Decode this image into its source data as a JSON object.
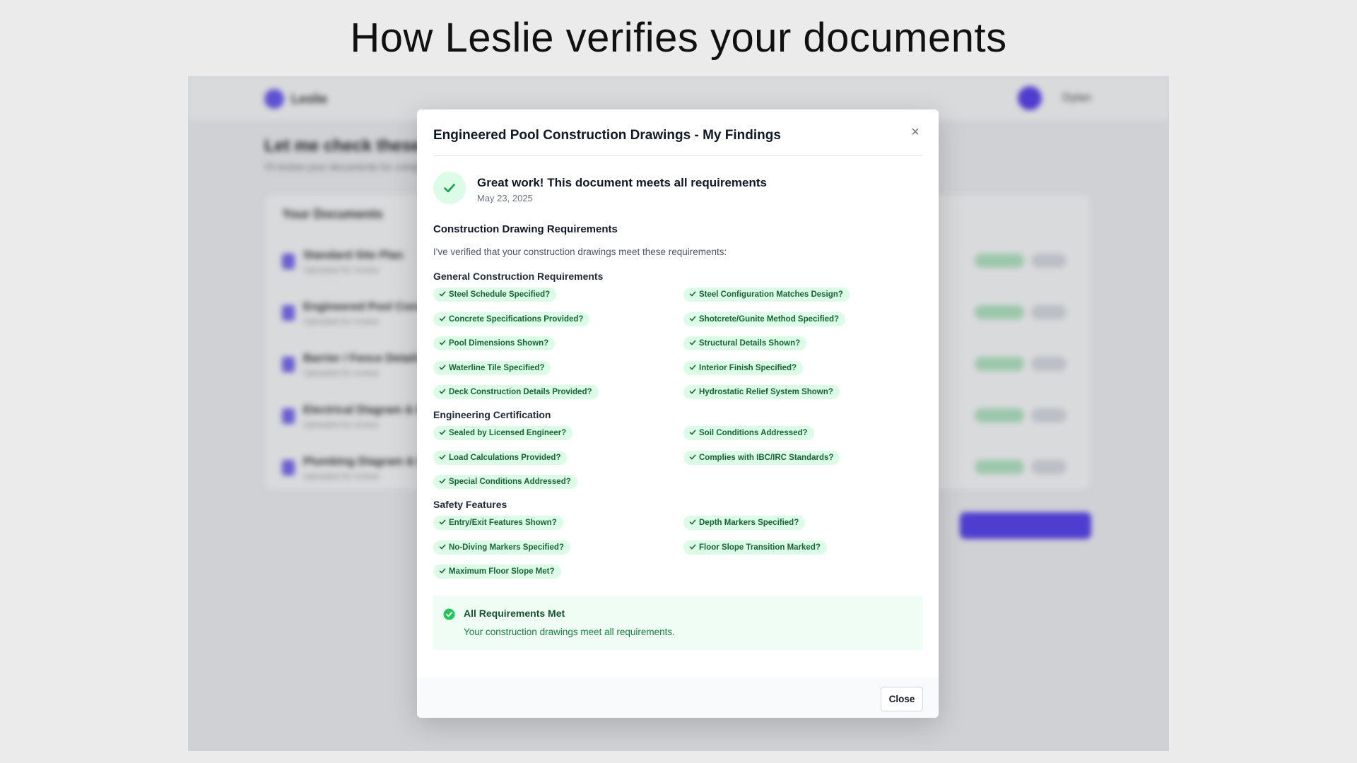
{
  "headline": "How Leslie verifies your documents",
  "app": {
    "logo_text": "Leslie",
    "user_name": "Dylan",
    "page_title": "Let me check these documents",
    "page_subtitle": "I'll review your documents for completeness",
    "docs_card_title": "Your Documents",
    "documents": [
      {
        "name": "Standard Site Plan",
        "meta": "Uploaded for review"
      },
      {
        "name": "Engineered Pool Construction Drawings",
        "meta": "Uploaded for review"
      },
      {
        "name": "Barrier / Fence Details",
        "meta": "Uploaded for review"
      },
      {
        "name": "Electrical Diagram & Bonding",
        "meta": "Uploaded for review"
      },
      {
        "name": "Plumbing Diagram & Equipment",
        "meta": "Uploaded for review"
      }
    ]
  },
  "modal": {
    "title": "Engineered Pool Construction Drawings - My Findings",
    "close_symbol": "×",
    "status_title": "Great work! This document meets all requirements",
    "status_date": "May 23, 2025",
    "section_heading": "Construction Drawing Requirements",
    "intro": "I've verified that your construction drawings meet these requirements:",
    "groups": [
      {
        "title": "General Construction Requirements",
        "items": [
          "Steel Schedule Specified?",
          "Steel Configuration Matches Design?",
          "Concrete Specifications Provided?",
          "Shotcrete/Gunite Method Specified?",
          "Pool Dimensions Shown?",
          "Structural Details Shown?",
          "Waterline Tile Specified?",
          "Interior Finish Specified?",
          "Deck Construction Details Provided?",
          "Hydrostatic Relief System Shown?"
        ]
      },
      {
        "title": "Engineering Certification",
        "items": [
          "Sealed by Licensed Engineer?",
          "Soil Conditions Addressed?",
          "Load Calculations Provided?",
          "Complies with IBC/IRC Standards?",
          "Special Conditions Addressed?"
        ]
      },
      {
        "title": "Safety Features",
        "items": [
          "Entry/Exit Features Shown?",
          "Depth Markers Specified?",
          "No-Diving Markers Specified?",
          "Floor Slope Transition Marked?",
          "Maximum Floor Slope Met?"
        ]
      }
    ],
    "summary_title": "All Requirements Met",
    "summary_text": "Your construction drawings meet all requirements.",
    "close_button": "Close"
  },
  "colors": {
    "accent": "#5b45f0",
    "success_bg": "#dcfce7",
    "success_text": "#166534",
    "success_icon": "#22c55e"
  },
  "icons": {
    "status": "check-icon",
    "pill": "check-icon",
    "summary": "check-circle-icon",
    "close": "close-icon"
  }
}
